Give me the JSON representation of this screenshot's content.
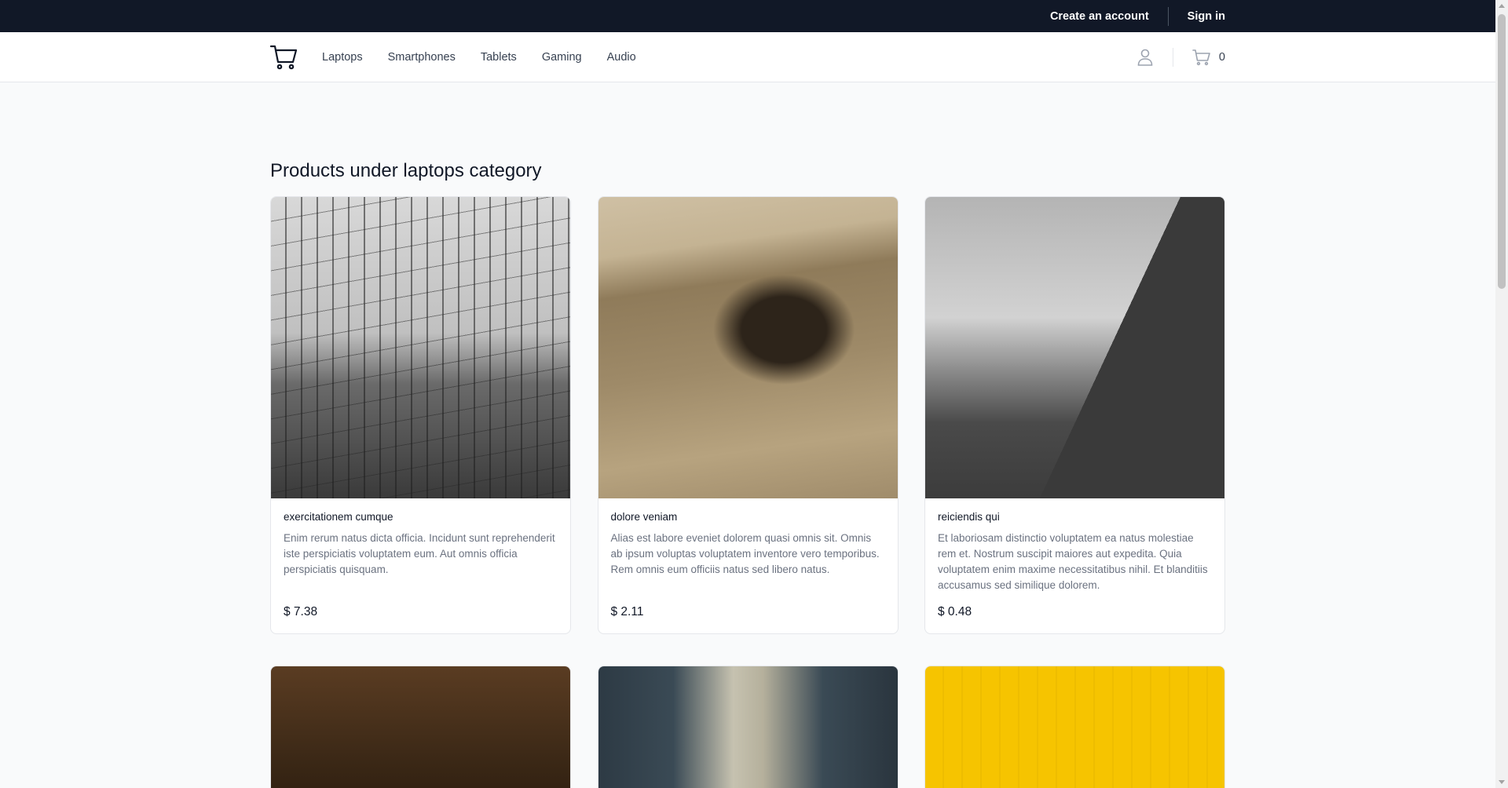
{
  "topbar": {
    "create_account": "Create an account",
    "sign_in": "Sign in"
  },
  "nav": {
    "logo_icon": "cart-logo-icon",
    "links": [
      "Laptops",
      "Smartphones",
      "Tablets",
      "Gaming",
      "Audio"
    ],
    "user_icon": "user-icon",
    "cart_icon": "cart-icon",
    "cart_count": "0"
  },
  "main": {
    "title": "Products under laptops category",
    "products": [
      {
        "name": "exercitationem cumque",
        "description": "Enim rerum natus dicta officia. Incidunt sunt reprehenderit iste perspiciatis voluptatem eum. Aut omnis officia perspiciatis quisquam.",
        "price": "$ 7.38"
      },
      {
        "name": "dolore veniam",
        "description": "Alias est labore eveniet dolorem quasi omnis sit. Omnis ab ipsum voluptas voluptatem inventore vero temporibus. Rem omnis eum officiis natus sed libero natus.",
        "price": "$ 2.11"
      },
      {
        "name": "reiciendis qui",
        "description": "Et laboriosam distinctio voluptatem ea natus molestiae rem et. Nostrum suscipit maiores aut expedita. Quia voluptatem enim maxime necessitatibus nihil. Et blanditiis accusamus sed similique dolorem.",
        "price": "$ 0.48"
      }
    ]
  },
  "colors": {
    "topbar_bg": "#111827",
    "page_bg": "#f9fafb",
    "card_border": "#e5e7eb"
  }
}
